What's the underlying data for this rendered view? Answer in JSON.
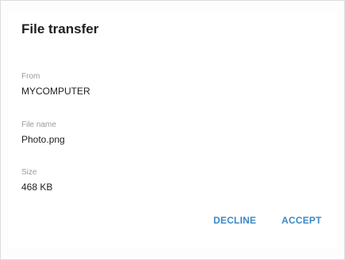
{
  "dialog": {
    "title": "File transfer",
    "fields": [
      {
        "label": "From",
        "value": "MYCOMPUTER"
      },
      {
        "label": "File name",
        "value": "Photo.png"
      },
      {
        "label": "Size",
        "value": "468 KB"
      }
    ],
    "buttons": {
      "decline": "DECLINE",
      "accept": "ACCEPT"
    }
  },
  "colors": {
    "accent": "#3a88c8",
    "title": "#1f1f1f",
    "label": "#9a9a9a",
    "value": "#222222"
  }
}
